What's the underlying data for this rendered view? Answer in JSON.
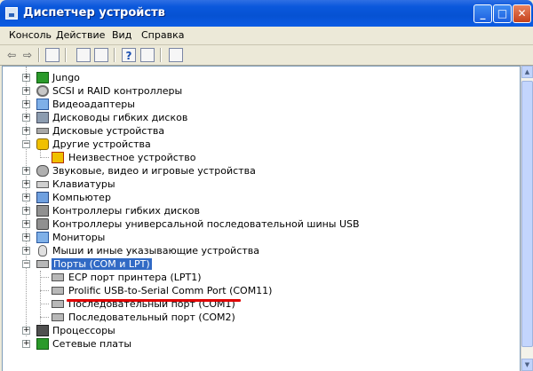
{
  "window": {
    "title": "Диспетчер устройств"
  },
  "titlebar_buttons": {
    "minimize": "_",
    "maximize": "□",
    "close": "✕"
  },
  "menu": [
    "Консоль",
    "Действие",
    "Вид",
    "Справка"
  ],
  "toolbar": {
    "back_icon": "⇦",
    "forward_icon": "⇨"
  },
  "tree": [
    {
      "label": "Jungo",
      "expander": "+",
      "icon": "green-card-icon"
    },
    {
      "label": "SCSI и RAID контроллеры",
      "expander": "+",
      "icon": "gear-icon"
    },
    {
      "label": "Видеоадаптеры",
      "expander": "+",
      "icon": "monitor-icon"
    },
    {
      "label": "Дисководы гибких дисков",
      "expander": "+",
      "icon": "floppy-drive-icon"
    },
    {
      "label": "Дисковые устройства",
      "expander": "+",
      "icon": "disk-drive-icon"
    },
    {
      "label": "Другие устройства",
      "expander": "−",
      "icon": "question-device-icon"
    },
    {
      "label": "Неизвестное устройство",
      "icon": "unknown-device-warning-icon"
    },
    {
      "label": "Звуковые, видео и игровые устройства",
      "expander": "+",
      "icon": "speaker-icon"
    },
    {
      "label": "Клавиатуры",
      "expander": "+",
      "icon": "keyboard-icon"
    },
    {
      "label": "Компьютер",
      "expander": "+",
      "icon": "computer-icon"
    },
    {
      "label": "Контроллеры гибких дисков",
      "expander": "+",
      "icon": "controller-icon"
    },
    {
      "label": "Контроллеры универсальной последовательной шины USB",
      "expander": "+",
      "icon": "usb-icon"
    },
    {
      "label": "Мониторы",
      "expander": "+",
      "icon": "monitor-icon"
    },
    {
      "label": "Мыши и иные указывающие устройства",
      "expander": "+",
      "icon": "mouse-icon"
    },
    {
      "label": "Порты (COM и LPT)",
      "expander": "−",
      "icon": "port-icon"
    },
    {
      "label": "ECP порт принтера (LPT1)",
      "icon": "port-icon"
    },
    {
      "label": "Prolific USB-to-Serial Comm Port (COM11)",
      "icon": "port-icon"
    },
    {
      "label": "Последовательный порт (COM1)",
      "icon": "port-icon"
    },
    {
      "label": "Последовательный порт (COM2)",
      "icon": "port-icon"
    },
    {
      "label": "Процессоры",
      "expander": "+",
      "icon": "processor-icon"
    },
    {
      "label": "Сетевые платы",
      "expander": "+",
      "icon": "network-card-icon"
    }
  ],
  "colors": {
    "titlebar": "#0a58dc",
    "selection": "#316ac5",
    "annotation": "#e00000"
  },
  "scrollbar": {
    "up_arrow": "▲",
    "down_arrow": "▼"
  }
}
